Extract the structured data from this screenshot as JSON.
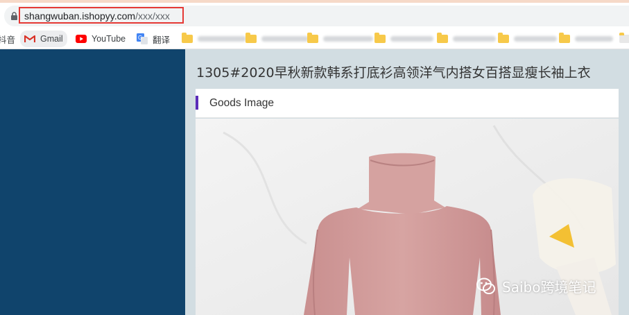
{
  "browser": {
    "url_host": "shangwuban.ishopyy.com",
    "url_path": "/xxx/xxx",
    "bookmarks": [
      {
        "label": "抖音",
        "icon": "page-icon"
      },
      {
        "label": "Gmail",
        "icon": "gmail-icon"
      },
      {
        "label": "YouTube",
        "icon": "youtube-icon"
      },
      {
        "label": "翻译",
        "icon": "google-translate-icon"
      }
    ]
  },
  "page": {
    "product_title": "1305#2020早秋新款韩系打底衫高领洋气内搭女百搭显瘦长袖上衣",
    "panel_label": "Goods Image",
    "watermark": "Saibo跨境笔记"
  },
  "colors": {
    "sidebar": "#10446c",
    "content_bg": "#d2dde2",
    "accent": "#5b2cb8",
    "highlight": "#e53935"
  }
}
